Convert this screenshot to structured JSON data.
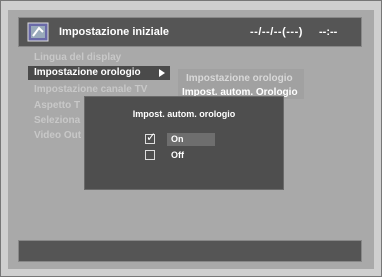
{
  "header": {
    "title": "Impostazione iniziale",
    "date": "--/--/--(---)",
    "time": "--:--"
  },
  "main_menu": {
    "items": [
      "Lingua del display",
      "Impostazione orologio",
      "Impostazione canale TV",
      "Aspetto T",
      "Seleziona",
      "Video Out"
    ]
  },
  "sub_menu": {
    "items": [
      "Impostazione orologio",
      "Impost. autom. Orologio"
    ]
  },
  "dialog": {
    "title": "Impost. autom. orologio",
    "options": [
      {
        "label": "On",
        "checked": true
      },
      {
        "label": "Off",
        "checked": false
      }
    ]
  }
}
